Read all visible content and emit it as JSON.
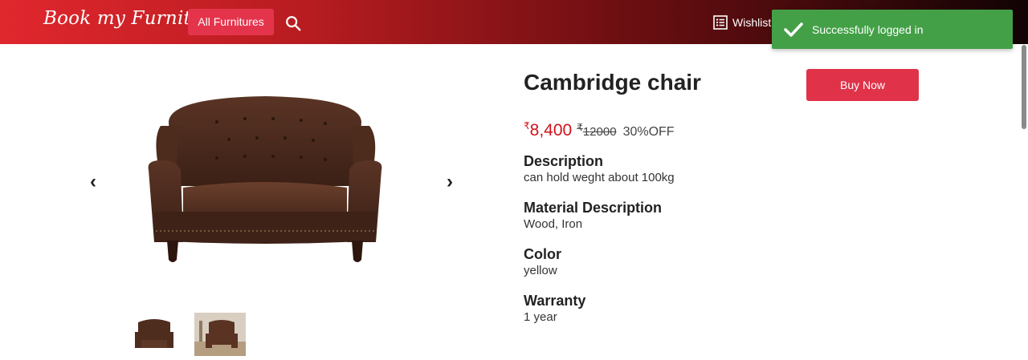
{
  "header": {
    "brand": "Book my Furniture",
    "all_furnitures_label": "All Furnitures",
    "search_icon": "search-icon",
    "wishlist_label": "Wishlist",
    "wishlist_icon": "list-icon",
    "gradient_colors": [
      "#e0272e",
      "#b71c20",
      "#6e0f12",
      "#120304"
    ]
  },
  "toast": {
    "message": "Successfully logged in",
    "icon": "check-icon",
    "color": "#43a047"
  },
  "gallery": {
    "prev_glyph": "‹",
    "next_glyph": "›",
    "thumbnail_count": 2,
    "selected_thumbnail": 1
  },
  "product": {
    "name": "Cambridge chair",
    "buy_label": "Buy Now",
    "currency_symbol": "₹",
    "price": "8,400",
    "mrp": "12000",
    "discount": "30%OFF",
    "price_color": "#d0121b",
    "details": [
      {
        "label": "Description",
        "value": "can hold weght about 100kg"
      },
      {
        "label": "Material Description",
        "value": "Wood, Iron"
      },
      {
        "label": "Color",
        "value": "yellow"
      },
      {
        "label": "Warranty",
        "value": "1 year"
      }
    ]
  }
}
